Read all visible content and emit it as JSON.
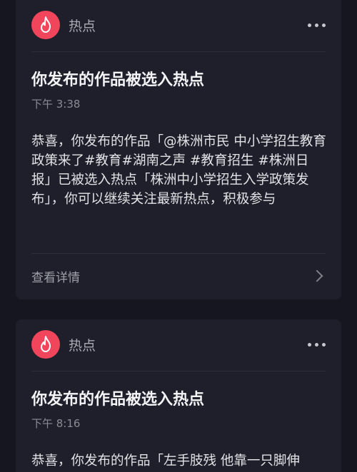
{
  "notifications": [
    {
      "source": "热点",
      "title": "你发布的作品被选入热点",
      "time": "下午 3:38",
      "body": "恭喜，你发布的作品「@株洲市民 中小学招生教育政策来了#教育#湖南之声 #教育招生 #株洲日报」已被选入热点「株洲中小学招生入学政策发布」，你可以继续关注最新热点，积极参与",
      "footer_label": "查看详情"
    },
    {
      "source": "热点",
      "title": "你发布的作品被选入热点",
      "time": "下午 8:16",
      "body": "恭喜，你发布的作品「左手肢残 他靠一只脚伸"
    }
  ],
  "colors": {
    "background": "#15161f",
    "card": "#1e1f2a",
    "accent_avatar": "#f0455a"
  },
  "icons": {
    "avatar": "flame-icon",
    "more": "more-dots-icon",
    "footer": "chevron-right-icon"
  }
}
